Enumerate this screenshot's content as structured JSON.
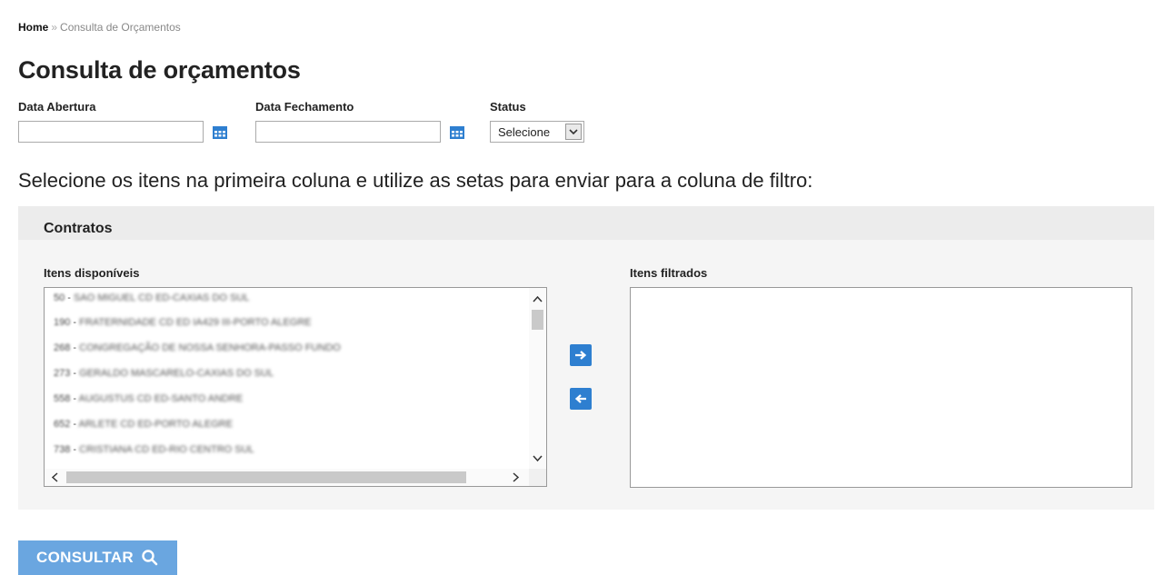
{
  "breadcrumb": {
    "home": "Home",
    "separator": "»",
    "current": "Consulta de Orçamentos"
  },
  "page_title": "Consulta de orçamentos",
  "filters": {
    "data_abertura_label": "Data Abertura",
    "data_abertura_value": "",
    "data_fechamento_label": "Data Fechamento",
    "data_fechamento_value": "",
    "status_label": "Status",
    "status_selected": "Selecione"
  },
  "instruction": "Selecione os itens na primeira coluna e utilize as setas para enviar para a coluna de filtro:",
  "contracts_panel": {
    "title": "Contratos",
    "available_label": "Itens disponíveis",
    "filtered_label": "Itens filtrados",
    "available_items": [
      {
        "code": "50",
        "name": "SAO MIGUEL CD ED-CAXIAS DO SUL"
      },
      {
        "code": "190",
        "name": "FRATERNIDADE CD ED IA429 III-PORTO ALEGRE"
      },
      {
        "code": "268",
        "name": "CONGREGAÇÃO DE NOSSA SENHORA-PASSO FUNDO"
      },
      {
        "code": "273",
        "name": "GERALDO MASCARELO-CAXIAS DO SUL"
      },
      {
        "code": "558",
        "name": "AUGUSTUS CD ED-SANTO ANDRE"
      },
      {
        "code": "652",
        "name": "ARLETE CD ED-PORTO ALEGRE"
      },
      {
        "code": "738",
        "name": "CRISTIANA CD ED-RIO CENTRO SUL"
      }
    ],
    "filtered_items": []
  },
  "actions": {
    "consult_label": "CONSULTAR"
  },
  "icons": {
    "calendar": "calendar-icon",
    "dropdown": "chevron-down-icon",
    "move_right": "arrow-right-icon",
    "move_left": "arrow-left-icon",
    "search": "search-icon"
  },
  "colors": {
    "accent": "#2e7fd0",
    "consult_button": "#6aa6e0"
  }
}
